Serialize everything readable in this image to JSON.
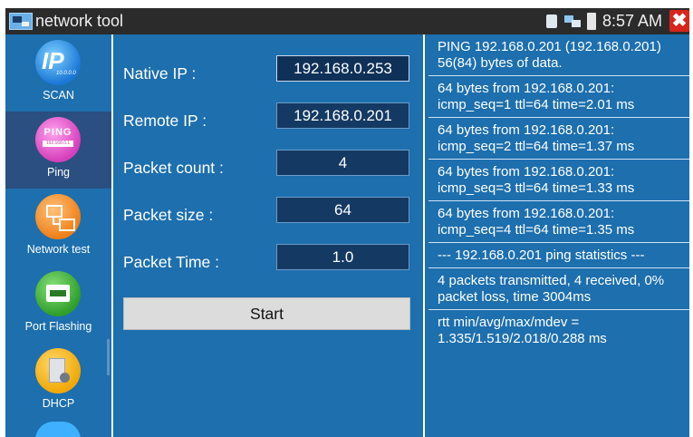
{
  "titlebar": {
    "app_name": "network tool",
    "time": "8:57 AM",
    "icons": [
      "sd-card-icon",
      "network-status-icon",
      "battery-icon",
      "close-icon"
    ],
    "close_glyph": "✖"
  },
  "sidebar": {
    "items": [
      {
        "label": "SCAN",
        "icon": "ip-scan-icon",
        "icon_text": "IP",
        "icon_subtext": "10.0.0.0",
        "selected": false
      },
      {
        "label": "Ping",
        "icon": "ping-icon",
        "icon_text": "PING",
        "icon_subtext": "192.168.0.1",
        "selected": true
      },
      {
        "label": "Network test",
        "icon": "network-test-icon",
        "selected": false
      },
      {
        "label": "Port Flashing",
        "icon": "port-flashing-icon",
        "selected": false
      },
      {
        "label": "DHCP",
        "icon": "dhcp-icon",
        "selected": false
      }
    ]
  },
  "form": {
    "native_ip": {
      "label": "Native IP :",
      "value": "192.168.0.253"
    },
    "remote_ip": {
      "label": "Remote IP :",
      "value": "192.168.0.201"
    },
    "packet_count": {
      "label": "Packet count :",
      "value": "4"
    },
    "packet_size": {
      "label": "Packet size :",
      "value": "64"
    },
    "packet_time": {
      "label": "Packet Time :",
      "value": "1.0"
    },
    "start_label": "Start"
  },
  "results": {
    "lines": [
      "PING 192.168.0.201 (192.168.0.201) 56(84) bytes of data.",
      "64 bytes from 192.168.0.201: icmp_seq=1 ttl=64 time=2.01 ms",
      "64 bytes from 192.168.0.201: icmp_seq=2 ttl=64 time=1.37 ms",
      "64 bytes from 192.168.0.201: icmp_seq=3 ttl=64 time=1.33 ms",
      "64 bytes from 192.168.0.201: icmp_seq=4 ttl=64 time=1.35 ms",
      "--- 192.168.0.201 ping statistics ---",
      "4 packets transmitted, 4 received, 0% packet loss, time 3004ms",
      "rtt min/avg/max/mdev = 1.335/1.519/2.018/0.288 ms"
    ]
  },
  "colors": {
    "background": "#1d6fae",
    "titlebar": "#2b2b2b",
    "field_background": "#143a63",
    "selected_item": "#2a4f80",
    "close_button": "#d7261c",
    "start_button": "#dcdcdc"
  }
}
